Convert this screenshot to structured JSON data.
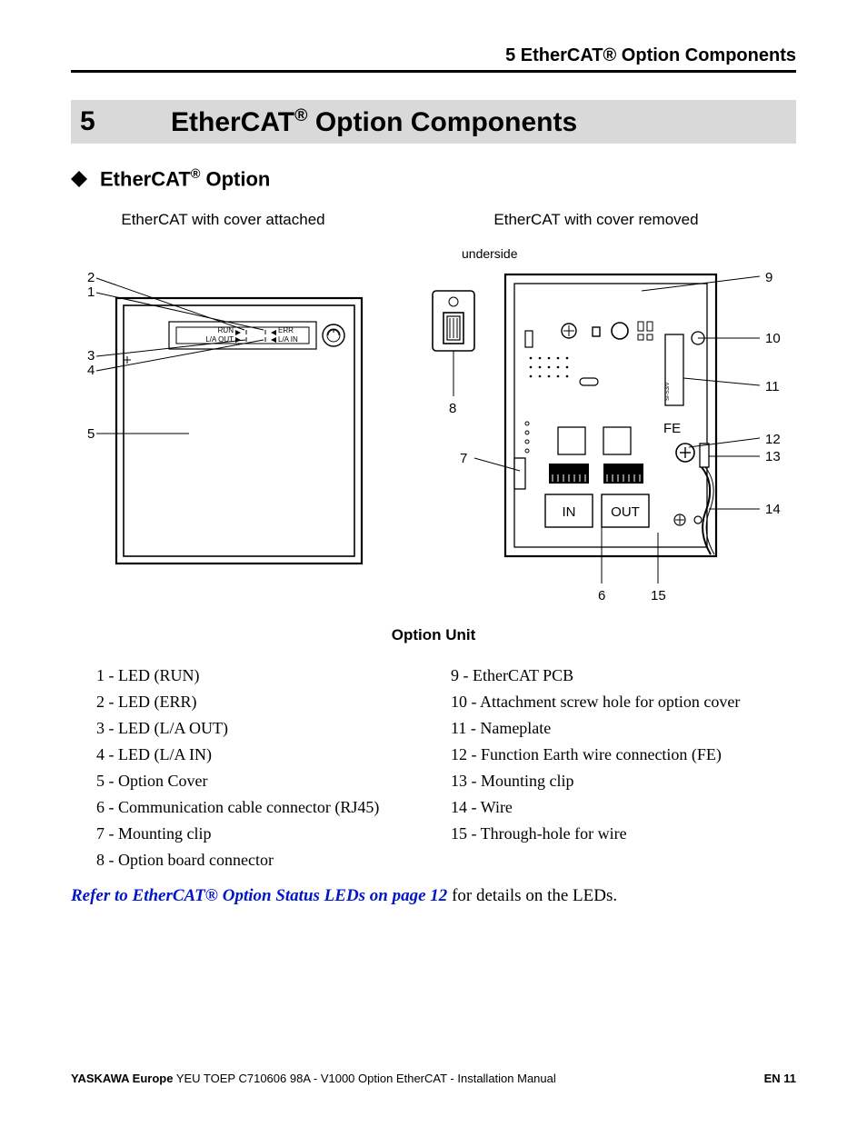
{
  "header": "5  EtherCAT® Option Components",
  "chapter": {
    "num": "5",
    "title_a": "EtherCAT",
    "title_b": " Option Components"
  },
  "section": {
    "a": "EtherCAT",
    "b": " Option"
  },
  "figs": {
    "left_caption": "EtherCAT with cover attached",
    "right_caption": "EtherCAT with cover removed",
    "underside": "underside",
    "main_caption": "Option Unit",
    "labels": {
      "run": "RUN",
      "err": "ERR",
      "laout": "L/A OUT",
      "lain": "L/A IN",
      "in": "IN",
      "out": "OUT",
      "fe": "FE"
    },
    "left_nums": {
      "n1": "1",
      "n2": "2",
      "n3": "3",
      "n4": "4",
      "n5": "5"
    },
    "right_nums": {
      "n6": "6",
      "n7": "7",
      "n8": "8",
      "n9": "9",
      "n10": "10",
      "n11": "11",
      "n12": "12",
      "n13": "13",
      "n14": "14",
      "n15": "15"
    }
  },
  "legend_left": [
    "1 - LED (RUN)",
    "2 - LED (ERR)",
    "3 - LED (L/A OUT)",
    "4 - LED (L/A IN)",
    "5 - Option Cover",
    "6 - Communication cable connector (RJ45)",
    "7 - Mounting clip",
    "8 - Option board connector"
  ],
  "legend_right": [
    "9 - EtherCAT PCB",
    "10 - Attachment screw hole for option cover",
    "11 - Nameplate",
    "12 - Function Earth wire connection (FE)",
    "13 - Mounting clip",
    "14 - Wire",
    "15 - Through-hole for wire"
  ],
  "ref": {
    "link": "Refer to EtherCAT® Option Status LEDs on page 12",
    "rest": " for details on the LEDs."
  },
  "footer": {
    "brand": "YASKAWA Europe",
    "rest": " YEU TOEP C710606 98A - V1000 Option EtherCAT - Installation Manual",
    "page": "EN 11"
  }
}
